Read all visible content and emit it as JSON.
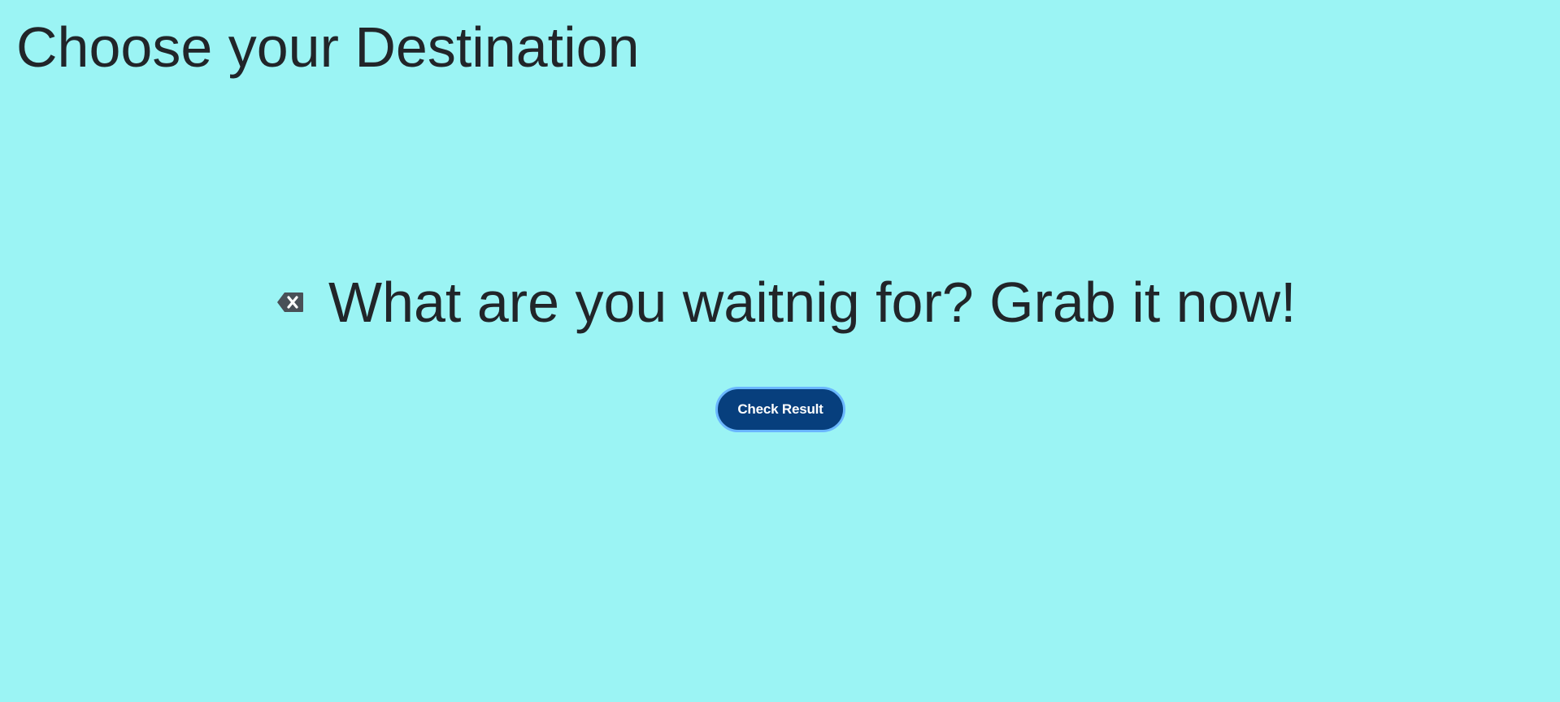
{
  "page": {
    "title": "Choose your Destination"
  },
  "prompt": {
    "icon": "backspace-icon",
    "text": "What are you waitnig for? Grab it now!"
  },
  "actions": {
    "check_result_label": "Check Result"
  },
  "colors": {
    "background": "#9bf4f4",
    "text": "#212529",
    "button_background": "#073f7d",
    "button_border": "#6ab7ff",
    "button_text": "#ffffff"
  }
}
